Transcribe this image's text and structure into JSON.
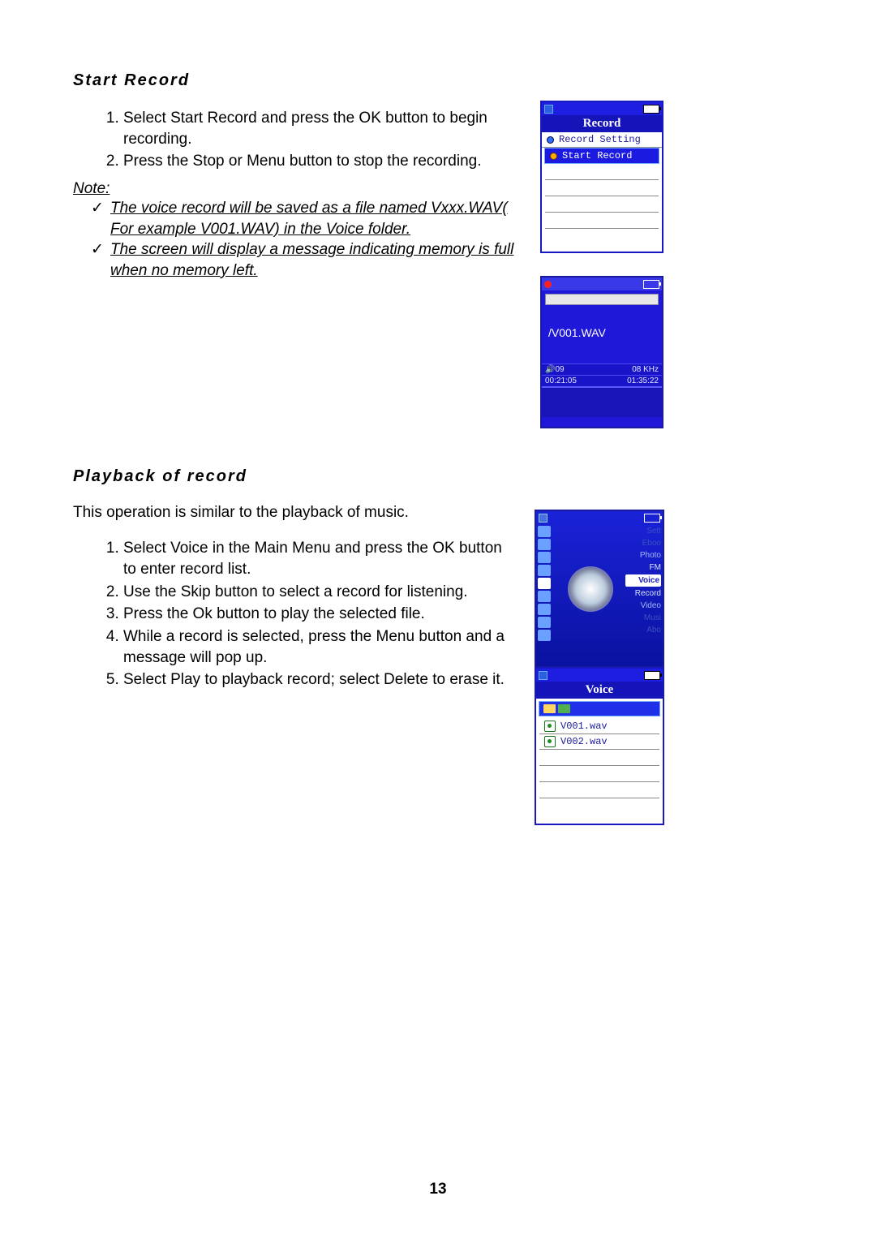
{
  "section1": {
    "heading": "Start Record",
    "steps": [
      "Select Start Record and press the OK button to begin recording.",
      "Press the Stop or Menu button to stop the recording."
    ],
    "note_label": "Note:",
    "notes": [
      "The voice record will be saved as a file named Vxxx.WAV( For example V001.WAV) in the Voice folder.",
      "The screen will display a message indicating memory is full when no memory left."
    ]
  },
  "fig_record": {
    "title": "Record",
    "item_plain": "Record Setting",
    "item_selected": "Start Record"
  },
  "fig_progress": {
    "filename": "/V001.WAV",
    "vol": "09",
    "khz": "08 KHz",
    "elapsed": "00:21:05",
    "remain": "01:35:22"
  },
  "fig_menu": {
    "labels": {
      "sett": "Sett",
      "eboo": "Eboo",
      "photo": "Photo",
      "fm": "FM",
      "voice": "Voice",
      "record": "Record",
      "video": "Video",
      "musi": "Musi",
      "abo": "Abo"
    }
  },
  "fig_voice": {
    "title": "Voice",
    "files": [
      "V001.wav",
      "V002.wav"
    ]
  },
  "section2": {
    "heading": "Playback of record",
    "intro": "This operation is similar to the playback of music.",
    "steps": [
      "Select Voice in the Main Menu and press the OK button to enter record list.",
      "Use the Skip button to select a record for listening.",
      "Press the Ok button to play the selected file.",
      "While a record is selected, press the Menu button and a message will pop up.",
      "Select Play to playback record; select Delete to erase it."
    ]
  },
  "page_number": "13"
}
